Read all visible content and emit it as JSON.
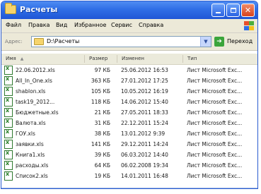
{
  "window": {
    "title": "Расчеты"
  },
  "menu": {
    "items": [
      "Файл",
      "Правка",
      "Вид",
      "Избранное",
      "Сервис",
      "Справка"
    ]
  },
  "address": {
    "label": "Адрес:",
    "value": "D:\\Расчеты",
    "go_label": "Переход"
  },
  "columns": {
    "name": "Имя",
    "size": "Размер",
    "modified": "Изменен",
    "type": "Тип"
  },
  "files": [
    {
      "name": "22.06.2012.xls",
      "size": "97 КБ",
      "modified": "25.06.2012 16:53",
      "type": "Лист Microsoft Exc..."
    },
    {
      "name": "All_In_One.xls",
      "size": "363 КБ",
      "modified": "27.01.2012 17:25",
      "type": "Лист Microsoft Exc..."
    },
    {
      "name": "shablon.xls",
      "size": "105 КБ",
      "modified": "10.05.2012 16:19",
      "type": "Лист Microsoft Exc..."
    },
    {
      "name": "task19_2012...",
      "size": "118 КБ",
      "modified": "14.06.2012 15:40",
      "type": "Лист Microsoft Exc..."
    },
    {
      "name": "Бюджетные.xls",
      "size": "21 КБ",
      "modified": "27.05.2011 18:33",
      "type": "Лист Microsoft Exc..."
    },
    {
      "name": "Валюта.xls",
      "size": "31 КБ",
      "modified": "22.12.2011 15:24",
      "type": "Лист Microsoft Exc..."
    },
    {
      "name": "ГОУ.xls",
      "size": "38 КБ",
      "modified": "13.01.2012 9:39",
      "type": "Лист Microsoft Exc..."
    },
    {
      "name": "заявки.xls",
      "size": "141 КБ",
      "modified": "29.12.2011 14:24",
      "type": "Лист Microsoft Exc..."
    },
    {
      "name": "Книга1.xls",
      "size": "39 КБ",
      "modified": "06.03.2012 14:40",
      "type": "Лист Microsoft Exc..."
    },
    {
      "name": "расходы.xls",
      "size": "64 КБ",
      "modified": "06.02.2008 19:34",
      "type": "Лист Microsoft Exc..."
    },
    {
      "name": "Список2.xls",
      "size": "19 КБ",
      "modified": "14.01.2011 16:48",
      "type": "Лист Microsoft Exc..."
    }
  ]
}
